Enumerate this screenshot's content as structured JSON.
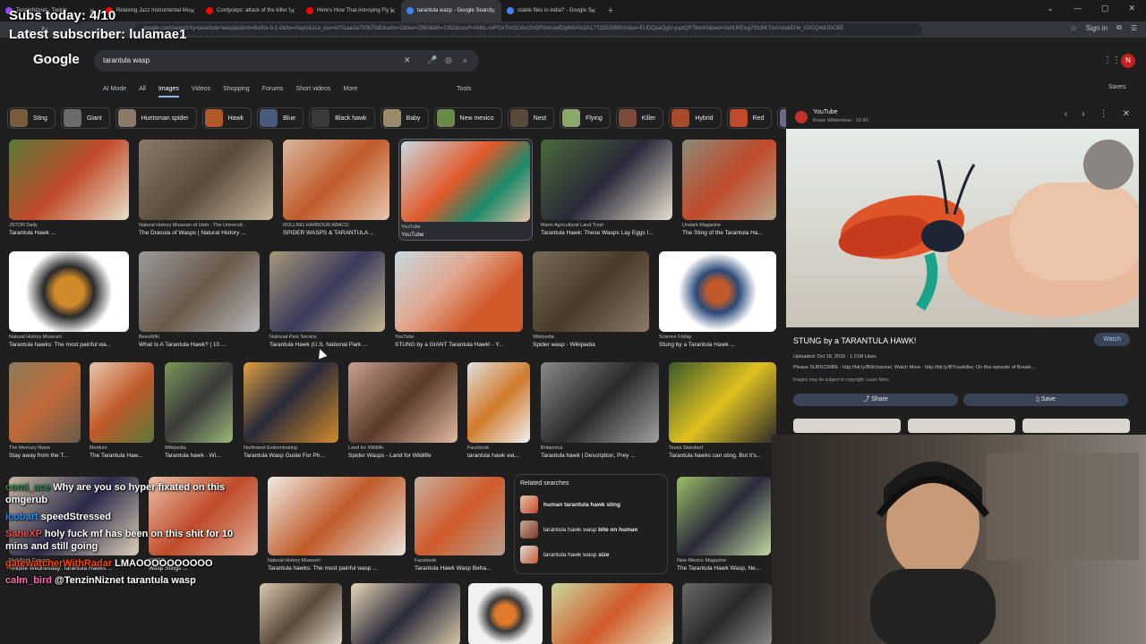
{
  "stream_overlay": {
    "subs_today": "Subs today: 4/10",
    "latest_subscriber": "Latest subscriber: lulamae1"
  },
  "browser": {
    "tabs": [
      {
        "label": "TenzinNiznet - Twitch",
        "color": "#9147ff",
        "active": false
      },
      {
        "label": "Relaxing Jazz Instrumental Mu",
        "color": "#ff0000",
        "active": false
      },
      {
        "label": "Cordyceps: attack of the killer f",
        "color": "#ff0000",
        "active": false
      },
      {
        "label": "Here's How That Annoying Fly I",
        "color": "#ff0000",
        "active": false
      },
      {
        "label": "tarantula wasp - Google Search",
        "color": "#4285f4",
        "active": true
      },
      {
        "label": "stable flies in india? - Google S",
        "color": "#4285f4",
        "active": false
      }
    ],
    "url": "google.com/search?q=tarantula+wasp&client=firefox-b-1-d&hs=HayU&sca_esv=e701aa2a750b70d5&udm=2&biw=2560&bih=1355&sxsrf=ANbL-n4FGxTmGLVkoShDPVohowfDgW6A%3A1772552569910&ei=EUDQaaQgN-ysptQP78vrA0&ved=0ahUKEwjj7lSt3tKTAxVsIokEHe_IGICQ4dUDCBE",
    "sign_in": "Sign in"
  },
  "google": {
    "logo": "Google",
    "query": "tarantula wasp",
    "tabs": [
      "AI Mode",
      "All",
      "Images",
      "Videos",
      "Shopping",
      "Forums",
      "Short videos",
      "More"
    ],
    "active_tab": "Images",
    "tools": "Tools",
    "saves": "Saves",
    "avatar_initial": "N"
  },
  "chips": [
    {
      "label": "Sting",
      "color": "#7a5b3a"
    },
    {
      "label": "Giant",
      "color": "#6b6b6b"
    },
    {
      "label": "Huntsman spider",
      "color": "#8a7a6a"
    },
    {
      "label": "Hawk",
      "color": "#b35a2a"
    },
    {
      "label": "Blue",
      "color": "#4a5a7a"
    },
    {
      "label": "Black hawk",
      "color": "#3a3a3a"
    },
    {
      "label": "Baby",
      "color": "#9a8a6a"
    },
    {
      "label": "New mexico",
      "color": "#6a8a4a"
    },
    {
      "label": "Nest",
      "color": "#5a4a3a"
    },
    {
      "label": "Flying",
      "color": "#8aa86a"
    },
    {
      "label": "Killer",
      "color": "#7a4a3a"
    },
    {
      "label": "Hybrid",
      "color": "#a84a2a"
    },
    {
      "label": "Red",
      "color": "#c04a2a"
    },
    {
      "label": "Ma",
      "color": "#6a6a8a"
    }
  ],
  "results": [
    {
      "source": "JSTOR Daily",
      "caption": "Tarantula Hawk ...",
      "bg": "linear-gradient(135deg,#5a7a3a,#c04a2a 50%,#e8e0c8)"
    },
    {
      "source": "Natural History Museum of Utah - The Universit...",
      "caption": "The Dracula of Wasps | Natural History ...",
      "bg": "linear-gradient(135deg,#8a7a6a,#5a4a3a 50%,#c8b8a0)"
    },
    {
      "source": "ROLLING HARBOUR ABACO",
      "caption": "SPIDER WASPS & TARANTULA ...",
      "bg": "linear-gradient(135deg,#d8b8a0,#c05a2a 50%,#e8c8b0)"
    },
    {
      "source": "YouTube",
      "caption": "YouTube",
      "bg": "linear-gradient(135deg,#c8d8e0,#e05a2a 45%,#1a8a6a 70%,#e8c0a8)"
    },
    {
      "source": "Marin Agricultural Land Trust",
      "caption": "Tarantula Hawk: These Wasps Lay Eggs I...",
      "bg": "linear-gradient(135deg,#4a6a3a,#2a2a3a 50%,#e8e0d0)"
    },
    {
      "source": "Undark Magazine",
      "caption": "The Sting of the Tarantula Ha...",
      "bg": "linear-gradient(135deg,#8a8a7a,#c04a2a 50%,#b8a890)"
    },
    {
      "source": "Natural History Museum",
      "caption": "Tarantula hawks: The most painful wa...",
      "bg": "radial-gradient(circle,#d08a2a 20%,#2a2a2a 35%,#ffffff 60%)"
    },
    {
      "source": "BeesWiki",
      "caption": "What Is A Tarantula Hawk? | 10 ...",
      "bg": "linear-gradient(135deg,#9a9a9a,#6a5a4a 50%,#b8b8b8)"
    },
    {
      "source": "National Park Service",
      "caption": "Tarantula Hawk (U.S. National Park ...",
      "bg": "linear-gradient(135deg,#a89a7a,#3a3a5a 50%,#c8b890)"
    },
    {
      "source": "YouTube",
      "caption": "STUNG by a GIANT Tarantula Hawk! - Y...",
      "bg": "linear-gradient(135deg,#c8d8e0,#e0a890 40%,#d05a2a 70%)"
    },
    {
      "source": "Wikipedia",
      "caption": "Spider wasp - Wikipedia",
      "bg": "linear-gradient(135deg,#7a6a5a,#4a3a2a 50%,#8a7a6a)"
    },
    {
      "source": "Science Friday",
      "caption": "Stung by a Tarantula Hawk ...",
      "bg": "radial-gradient(circle,#c05a2a 15%,#2a4a7a 30%,#ffffff 55%)"
    },
    {
      "source": "The Mercury News",
      "caption": "Stay away from the T...",
      "bg": "linear-gradient(135deg,#8a7a5a,#c06a3a 50%,#6a5a4a)"
    },
    {
      "source": "Medium",
      "caption": "The Tarantula Haw...",
      "bg": "linear-gradient(135deg,#e8c8b0,#c05a2a 50%,#5a7a3a)"
    },
    {
      "source": "Wikipedia",
      "caption": "Tarantula hawk - Wi...",
      "bg": "linear-gradient(135deg,#7a9a5a,#3a3a3a 50%,#9aba7a)"
    },
    {
      "source": "Northwest Exterminating",
      "caption": "Tarantula Wasp Guide For Ph...",
      "bg": "linear-gradient(135deg,#e0a040,#2a2a3a 45%,#d08a2a)"
    },
    {
      "source": "Land for Wildlife",
      "caption": "Spider Wasps - Land for Wildlife",
      "bg": "linear-gradient(135deg,#c8a090,#5a3a2a 50%,#e0b8a0)"
    },
    {
      "source": "Facebook",
      "caption": "tarantula hawk wa...",
      "bg": "linear-gradient(135deg,#e0e0e0,#d07a2a 50%,#f0f0f0)"
    },
    {
      "source": "Britannica",
      "caption": "Tarantula hawk | Description, Prey ...",
      "bg": "linear-gradient(135deg,#8a8a8a,#2a2a2a 50%,#a0a0a0)"
    },
    {
      "source": "Texas Standard",
      "caption": "Tarantula hawks can sting. But it's...",
      "bg": "linear-gradient(135deg,#3a5a2a,#e0c020 50%,#2a2a2a)"
    },
    {
      "source": "Red Rock Canyon",
      "caption": "Wildlife Wednesday: Tarantula Hawks ...",
      "bg": "linear-gradient(135deg,#c8b8a0,#2a2a4a 50%,#e0d0b8)"
    },
    {
      "source": "WIRED",
      "caption": "Wasp Stings ...",
      "bg": "linear-gradient(135deg,#e8c0a8,#c04a2a 50%,#e0b098)"
    },
    {
      "source": "Natural History Museum",
      "caption": "Tarantula hawks: The most painful wasp ...",
      "bg": "linear-gradient(135deg,#f0ece4,#c05a2a 50%,#e8e4dc)"
    },
    {
      "source": "Facebook",
      "caption": "Tarantula Hawk Wasp Beha...",
      "bg": "linear-gradient(135deg,#c8b0a0,#d05a2a 50%,#b8a090)"
    },
    {
      "source": "New Mexico Magazine",
      "caption": "The Tarantula Hawk Wasp, Ne...",
      "bg": "linear-gradient(135deg,#9ac06a,#2a2a3a 50%,#c0d8a0)"
    },
    {
      "source": "",
      "caption": "",
      "bg": "linear-gradient(135deg,#d8c8b0,#5a4a3a 50%,#e0d8c8)"
    },
    {
      "source": "",
      "caption": "",
      "bg": "linear-gradient(135deg,#e8d8b8,#2a2a3a 50%,#d8c8a8)"
    },
    {
      "source": "",
      "caption": "",
      "bg": "radial-gradient(circle,#e07a2a 20%,#3a3a3a 35%,#f0f0f0 60%)"
    },
    {
      "source": "",
      "caption": "",
      "bg": "linear-gradient(135deg,#c8d8a0,#d05a2a 50%,#e8e0c0)"
    },
    {
      "source": "",
      "caption": "",
      "bg": "linear-gradient(135deg,#6a6a6a,#2a2a2a 50%,#8a8a8a)"
    }
  ],
  "related": {
    "title": "Related searches",
    "items": [
      {
        "bold": "human tarantula hawk sting",
        "rest": ""
      },
      {
        "bold": "",
        "normal": "tarantula hawk wasp ",
        "boldtail": "bite on human"
      },
      {
        "bold": "",
        "normal": "tarantula hawk wasp ",
        "boldtail": "size"
      }
    ]
  },
  "panel": {
    "source": "YouTube",
    "channel": "Brave Wilderness · 15:40",
    "title": "STUNG by a TARANTULA HAWK!",
    "watch": "Watch",
    "meta": "Uploaded: Oct 18, 2016 · 1.01M Likes",
    "description": "Please SUBSCRIBE - http://bit.ly/BWchannel, Watch More - http://bit.ly/BTcowkiller, On this episode of Breaki...",
    "more": "More",
    "copyright": "Images may be subject to copyright. Learn More",
    "share": "Share",
    "save": "Save"
  },
  "chat": [
    {
      "user": "comi_ace",
      "text": "Why are you so hyper fixated on this omgerub"
    },
    {
      "user": "icobart",
      "text": "speedStressed"
    },
    {
      "user": "SaneXP",
      "text": "holy fuck mf has been on this shit for 10 mins and still going"
    },
    {
      "user": "gatewatcherWithRadar",
      "text": "LMAOOOOOOOOOO"
    },
    {
      "user": "calm_bird",
      "text": "@TenzinNiznet tarantula wasp"
    }
  ]
}
